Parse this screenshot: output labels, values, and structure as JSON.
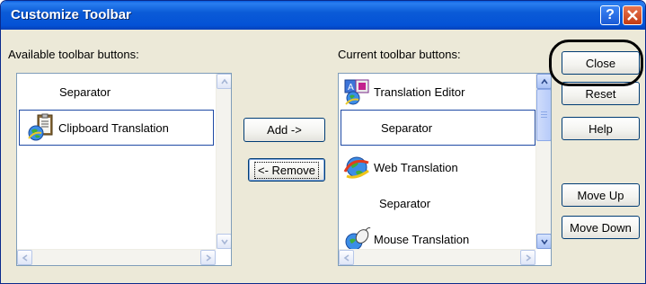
{
  "window": {
    "title": "Customize Toolbar",
    "help_glyph": "?",
    "close_glyph": "X"
  },
  "available": {
    "label": "Available toolbar buttons:",
    "items": [
      {
        "label": "Separator",
        "icon": "none"
      },
      {
        "label": "Clipboard Translation",
        "icon": "clipboard-globe-icon",
        "selected": true
      }
    ]
  },
  "current": {
    "label": "Current toolbar buttons:",
    "items": [
      {
        "label": "Translation Editor",
        "icon": "translation-editor-icon"
      },
      {
        "label": "Separator",
        "icon": "none",
        "selected": true
      },
      {
        "label": "Web Translation",
        "icon": "web-globe-icon"
      },
      {
        "label": "Separator",
        "icon": "none"
      },
      {
        "label": "Mouse Translation",
        "icon": "mouse-globe-icon"
      }
    ]
  },
  "buttons": {
    "add": "Add ->",
    "remove": "<- Remove",
    "close": "Close",
    "reset": "Reset",
    "help": "Help",
    "move_up": "Move Up",
    "move_down": "Move Down"
  },
  "colors": {
    "titlebar": "#0452d6",
    "dialog_bg": "#ece9d8",
    "selection_border": "#1f4aa5",
    "annotation": "#000000"
  }
}
